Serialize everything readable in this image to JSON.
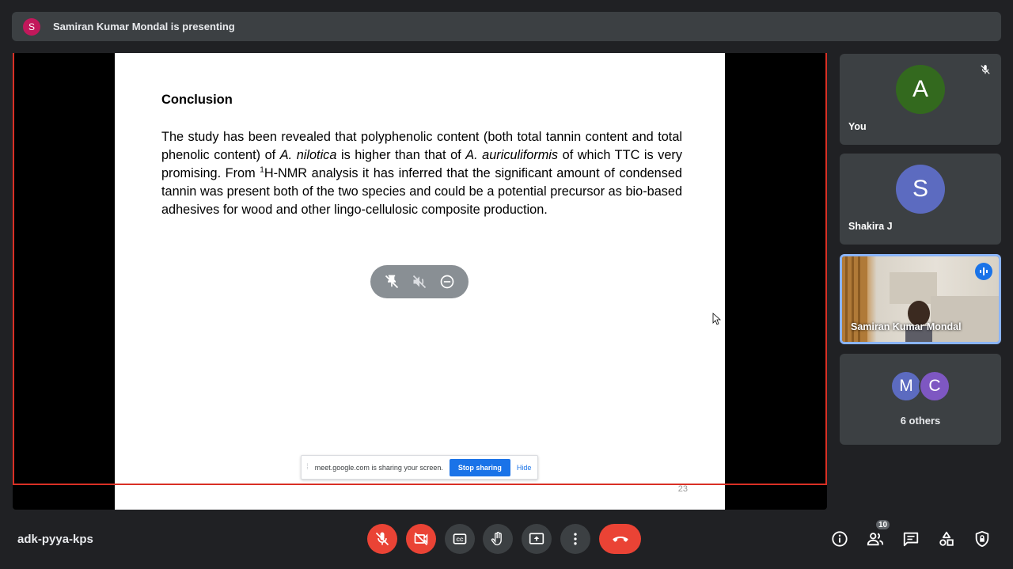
{
  "presenter_bar": {
    "avatar_initial": "S",
    "text": "Samiran Kumar Mondal is presenting"
  },
  "slide": {
    "heading": "Conclusion",
    "body_parts": {
      "p1": "The study has been revealed that polyphenolic content (both total tannin content and total phenolic content) of ",
      "species1": "A. nilotica",
      "p2": " is higher than that of ",
      "species2": "A. auriculiformis",
      "p3": " of which TTC is very promising. From ",
      "sup": "1",
      "p4": "H-NMR analysis it has inferred that the significant amount of condensed tannin was present both of the two species and could be a potential precursor as bio-based adhesives for wood and other lingo-cellulosic composite production."
    },
    "page_number": "23"
  },
  "share_banner": {
    "message": "meet.google.com is sharing your screen.",
    "stop_label": "Stop sharing",
    "hide_label": "Hide"
  },
  "participants": {
    "you": {
      "initial": "A",
      "name": "You",
      "color": "#33691e"
    },
    "shakira": {
      "initial": "S",
      "name": "Shakira J",
      "color": "#5c6bc0"
    },
    "samiran": {
      "name": "Samiran Kumar Mondal"
    },
    "others": {
      "avatars": [
        {
          "initial": "M",
          "color": "#5c6bc0"
        },
        {
          "initial": "C",
          "color": "#7e57c2"
        }
      ],
      "label": "6 others"
    }
  },
  "bottom_bar": {
    "meeting_code": "adk-pyya-kps",
    "people_count": "10"
  },
  "colors": {
    "accent": "#1a73e8",
    "danger": "#ea4335",
    "surface": "#3c4043",
    "background": "#202124"
  }
}
